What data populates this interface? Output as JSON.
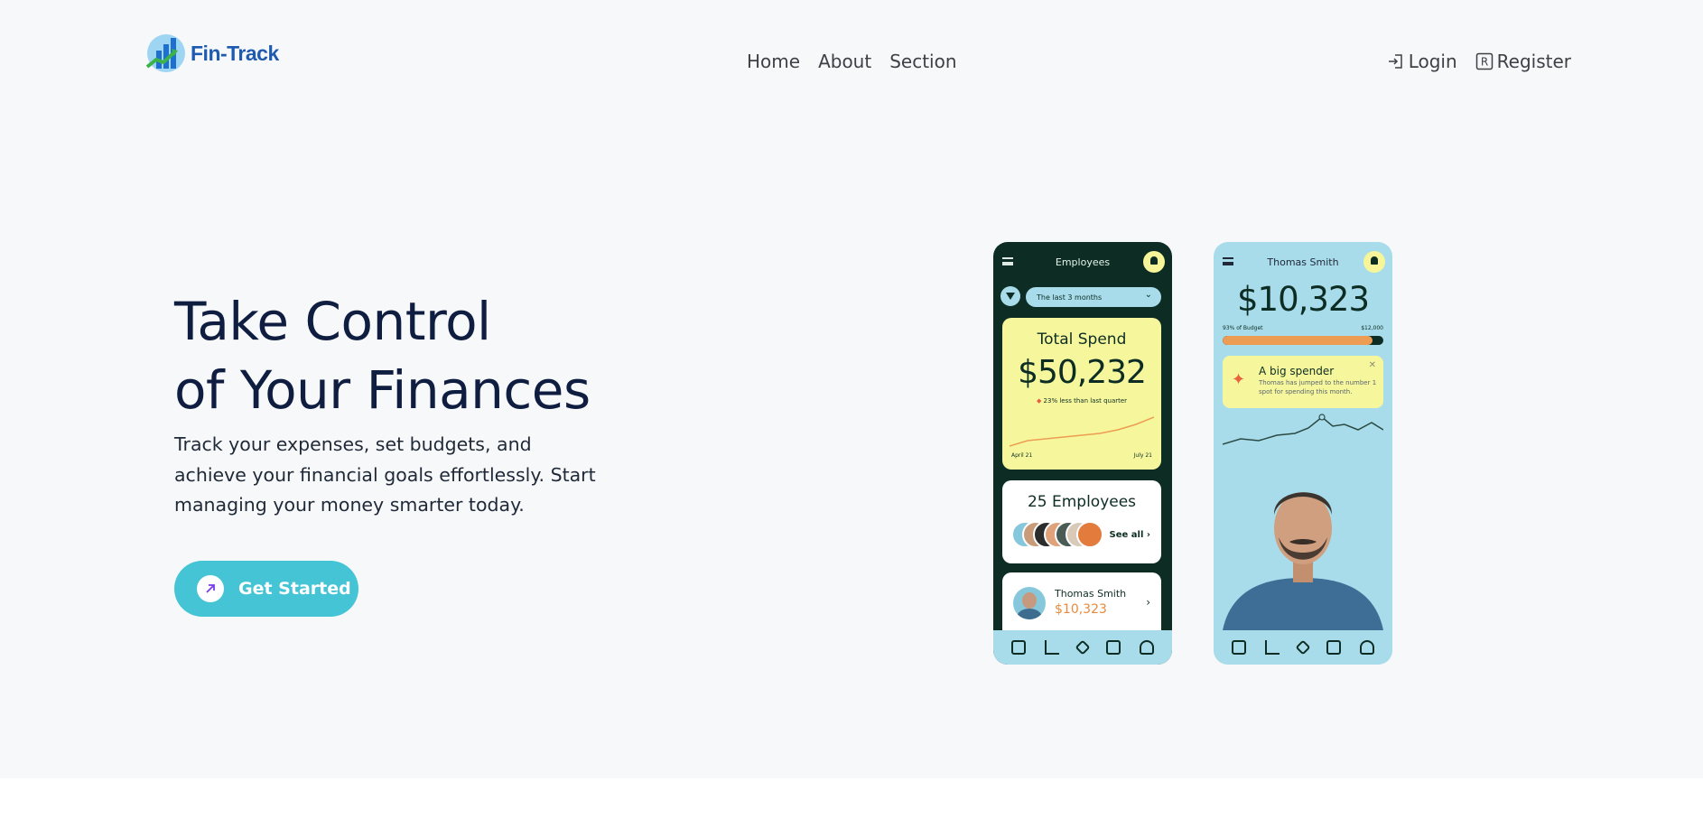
{
  "brand": {
    "name": "Fin-Track"
  },
  "nav": {
    "home": "Home",
    "about": "About",
    "section": "Section"
  },
  "auth": {
    "login": "Login",
    "register": "Register",
    "register_icon_letter": "R"
  },
  "hero": {
    "title_line1": "Take Control",
    "title_line2": "of Your Finances",
    "subtitle": "Track your expenses, set budgets, and achieve your financial goals effortlessly. Start managing your money smarter today.",
    "cta_label": "Get Started"
  },
  "phone_employees": {
    "title": "Employees",
    "filter": "The last 3 months",
    "spend_label": "Total Spend",
    "spend_value": "$50,232",
    "spend_note": "23% less than last quarter",
    "date_from": "April 21",
    "date_to": "July 21",
    "employees_label": "25 Employees",
    "see_all": "See all ›",
    "person_name": "Thomas Smith",
    "person_amount": "$10,323"
  },
  "phone_person": {
    "title": "Thomas Smith",
    "value": "$10,323",
    "budget_left": "93% of Budget",
    "budget_right": "$12,000",
    "budget_fraction": 0.93,
    "alert_title": "A big spender",
    "alert_text": "Thomas has jumped to the number 1 spot for spending this month."
  },
  "colors": {
    "accent": "#45c4d5",
    "dark_green": "#0d2d24",
    "yellow": "#f6f79c",
    "light_blue": "#a8dcea",
    "heading": "#0f1d40"
  },
  "icons": [
    "logo-icon",
    "login-icon",
    "register-icon",
    "arrow-up-right-icon",
    "menu-icon",
    "bell-icon",
    "filter-icon",
    "sparkle-icon",
    "close-icon"
  ]
}
